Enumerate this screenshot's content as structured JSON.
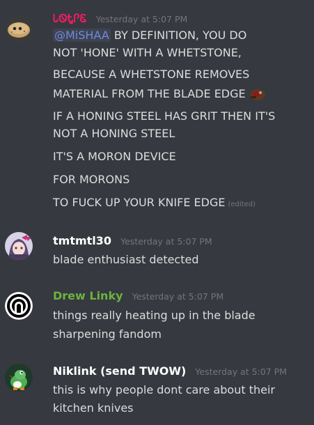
{
  "messages": [
    {
      "username": "ᏓᏫᎿᎵᏋ",
      "user_color": "#e91e63",
      "timestamp": "Yesterday at 5:07 PM",
      "mention": "@MiSHAA",
      "lines": [
        " BY DEFINITION, YOU DO",
        "NOT 'HONE' WITH A WHETSTONE,",
        "BECAUSE A WHETSTONE REMOVES",
        "MATERIAL FROM THE BLADE EDGE",
        "IF A HONING STEEL HAS GRIT THEN IT'S",
        "NOT A HONING STEEL",
        "IT'S A MORON DEVICE",
        "FOR MORONS",
        "TO FUCK UP YOUR KNIFE EDGE"
      ],
      "edited_label": "(edited)",
      "avatar_icon": "potato-avatar-icon",
      "emoji_icon": "custom-emoji-icon"
    },
    {
      "username": "tmtmtl30",
      "user_color": "#ffffff",
      "timestamp": "Yesterday at 5:07 PM",
      "lines": [
        "blade enthusiast detected"
      ],
      "avatar_icon": "anime-girl-avatar-icon"
    },
    {
      "username": "Drew Linky",
      "user_color": "#6bb33e",
      "timestamp": "Yesterday at 5:07 PM",
      "lines": [
        "things really heating up in the blade",
        "sharpening fandom"
      ],
      "avatar_icon": "ring-logo-avatar-icon"
    },
    {
      "username": "Niklink (send TWOW)",
      "user_color": "#ffffff",
      "timestamp": "Yesterday at 5:07 PM",
      "lines": [
        "this is why people dont care about their",
        "kitchen knives"
      ],
      "avatar_icon": "yoshi-avatar-icon"
    }
  ]
}
